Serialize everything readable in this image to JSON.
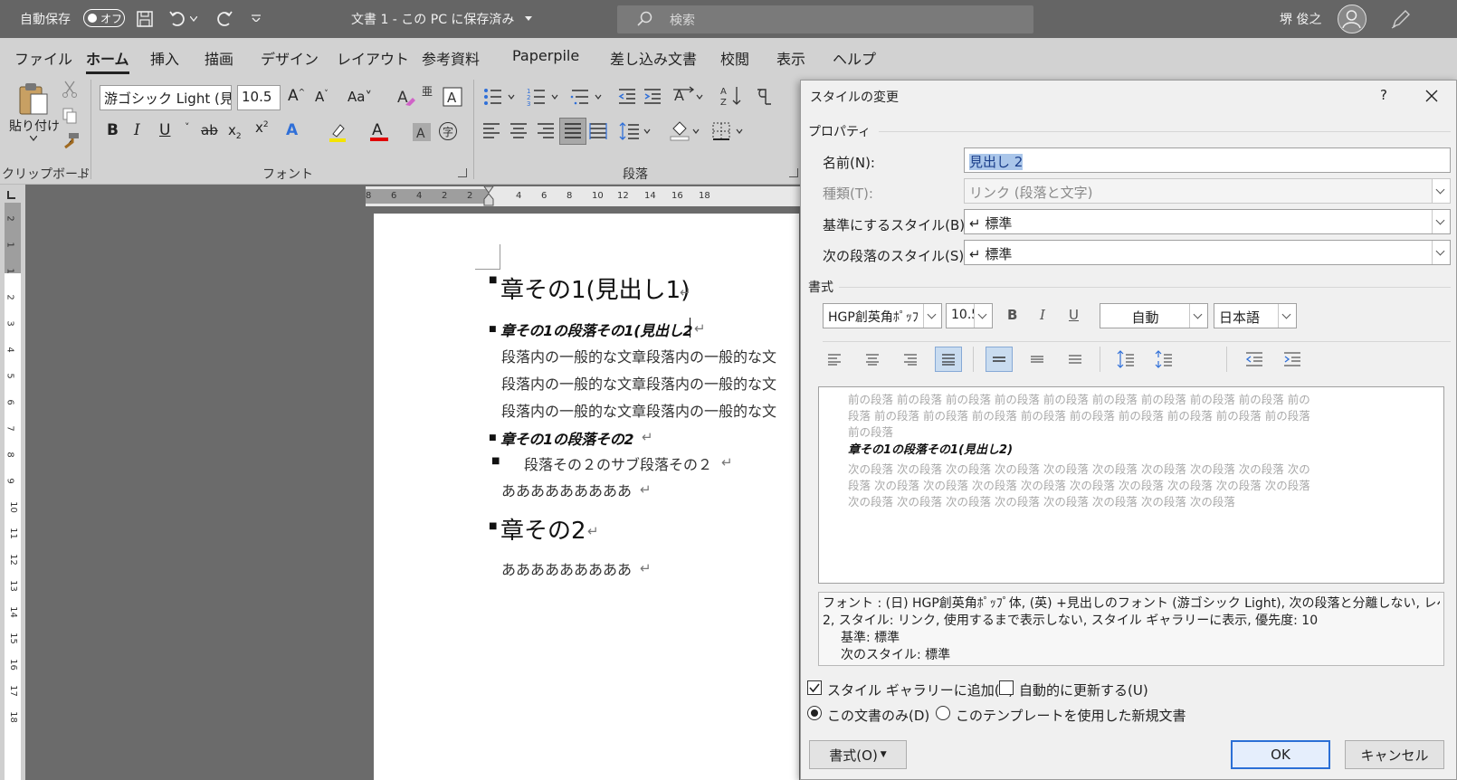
{
  "titlebar": {
    "autosave_label": "自動保存",
    "autosave_state": "オフ",
    "doc_title": "文書 1 - この PC に保存済み",
    "search_placeholder": "検索",
    "user_name": "堺 俊之"
  },
  "menu": {
    "tabs": [
      "ファイル",
      "ホーム",
      "挿入",
      "描画",
      "デザイン",
      "レイアウト",
      "参考資料",
      "Paperpile",
      "差し込み文書",
      "校閲",
      "表示",
      "ヘルプ"
    ],
    "active": "ホーム"
  },
  "ribbon": {
    "clipboard": {
      "paste_label": "貼り付け",
      "group_label": "クリップボード"
    },
    "font": {
      "font_name": "游ゴシック Light (見",
      "font_size": "10.5",
      "group_label": "フォント",
      "aa_label": "Aa",
      "kana_label": "亜"
    },
    "paragraph": {
      "group_label": "段落"
    }
  },
  "ruler": {
    "h_numbers": [
      "8",
      "6",
      "4",
      "2",
      "2",
      "4",
      "6",
      "8",
      "10",
      "12",
      "14",
      "16",
      "18"
    ],
    "v_numbers": [
      "2",
      "1",
      "1",
      "2",
      "3",
      "4",
      "5",
      "6",
      "7",
      "8",
      "9",
      "10",
      "11",
      "12",
      "13",
      "14",
      "15",
      "16",
      "17",
      "18"
    ]
  },
  "document": {
    "lines": [
      {
        "text": "章その1(見出し1)",
        "style": "h1"
      },
      {
        "text": "章その1の段落その1(見出し2",
        "style": "h2"
      },
      {
        "text": "段落内の一般的な文章段落内の一般的な文",
        "style": "body"
      },
      {
        "text": "段落内の一般的な文章段落内の一般的な文",
        "style": "body"
      },
      {
        "text": "段落内の一般的な文章段落内の一般的な文",
        "style": "body"
      },
      {
        "text": "章その1の段落その2",
        "style": "h2"
      },
      {
        "text": "段落その２のサブ段落その２",
        "style": "bullet"
      },
      {
        "text": "あああああああああ",
        "style": "body"
      },
      {
        "text": "章その2",
        "style": "h1"
      },
      {
        "text": "あああああああああ",
        "style": "body"
      }
    ]
  },
  "dialog": {
    "title": "スタイルの変更",
    "help": "?",
    "properties_label": "プロパティ",
    "name_label": "名前(N):",
    "name_value": "見出し 2",
    "type_label": "種類(T):",
    "type_value": "リンク (段落と文字)",
    "base_label": "基準にするスタイル(B):",
    "base_value": "↵ 標準",
    "next_label": "次の段落のスタイル(S):",
    "next_value": "↵ 標準",
    "format_label": "書式",
    "font_value": "HGP創英角ﾎﾟｯﾌ",
    "size_value": "10.5",
    "bold": "B",
    "italic": "I",
    "underline": "U",
    "color_value": "自動",
    "lang_value": "日本語",
    "preview": {
      "prev_1": "前の段落 前の段落 前の段落 前の段落 前の段落 前の段落 前の段落 前の段落 前の段落 前の",
      "prev_2": "段落 前の段落 前の段落 前の段落 前の段落 前の段落 前の段落 前の段落 前の段落 前の段落",
      "prev_3": "前の段落",
      "current": "章その1の段落その1(見出し2)",
      "next_1": "次の段落 次の段落 次の段落 次の段落 次の段落 次の段落 次の段落 次の段落 次の段落 次の",
      "next_2": "段落 次の段落 次の段落 次の段落 次の段落 次の段落 次の段落 次の段落 次の段落 次の段落",
      "next_3": "次の段落 次の段落 次の段落 次の段落 次の段落 次の段落 次の段落 次の段落"
    },
    "description": {
      "line1": "フォント : (日) HGP創英角ﾎﾟｯﾌﾟ体, (英) +見出しのフォント (游ゴシック Light), 次の段落と分離しない, レベル",
      "line2": "2, スタイル: リンク, 使用するまで表示しない, スタイル ギャラリーに表示, 優先度: 10",
      "line3": "基準: 標準",
      "line4": "次のスタイル: 標準"
    },
    "add_gallery_label": "スタイル ギャラリーに追加(S)",
    "auto_update_label": "自動的に更新する(U)",
    "this_doc_label": "この文書のみ(D)",
    "template_label": "このテンプレートを使用した新規文書",
    "format_button": "書式(O)",
    "ok_button": "OK",
    "cancel_button": "キャンセル"
  }
}
